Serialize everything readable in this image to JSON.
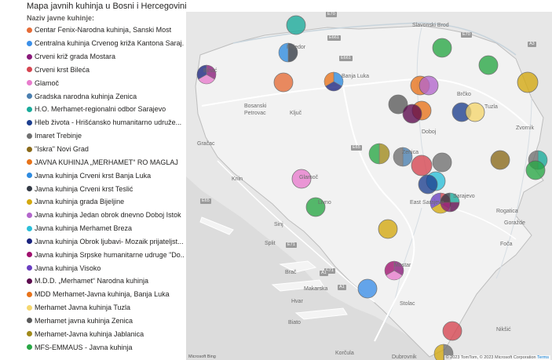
{
  "title": "Mapa javnih kuhinja u Bosni i Hercegovini",
  "legend": {
    "title": "Naziv javne kuhinje:",
    "items": [
      {
        "label": "Centar Fenix-Narodna kuhinja, Sanski Most",
        "color": "#e66c37"
      },
      {
        "label": "Centralna kuhinja Crvenog križa Kantona Saraj...",
        "color": "#3b8fe8"
      },
      {
        "label": "Crveni križ grada Mostara",
        "color": "#8a1a7a"
      },
      {
        "label": "Crveni krst Bileća",
        "color": "#d64550"
      },
      {
        "label": "Glamoč",
        "color": "#e87ccd"
      },
      {
        "label": "Gradska narodna kuhinja Zenica",
        "color": "#4a7fb0"
      },
      {
        "label": "H.O. Merhamet-regionalni odbor Sarajevo",
        "color": "#1aab9b"
      },
      {
        "label": "Hleb života - Hrišćansko humanitarno udruže...",
        "color": "#1d3f8f"
      },
      {
        "label": "Imaret Trebinje",
        "color": "#707070"
      },
      {
        "label": "\"Iskra\" Novi Grad",
        "color": "#8a6a1a"
      },
      {
        "label": "JAVNA KUHINJA „MERHAMET“ RO MAGLAJ",
        "color": "#e8731a"
      },
      {
        "label": "Javna kuhinja Crveni krst Banja Luka",
        "color": "#2e8be0"
      },
      {
        "label": "Javna kuhinja Crveni krst Teslić",
        "color": "#333a45"
      },
      {
        "label": "Javna kuhinja grada Bijeljine",
        "color": "#d4a90f"
      },
      {
        "label": "Javna kuhinja Jedan obrok dnevno Doboj Istok",
        "color": "#b366cc"
      },
      {
        "label": "Javna kuhinja Merhamet Breza",
        "color": "#2bbfd9"
      },
      {
        "label": "Javna kuhinja Obrok ljubavi- Mozaik prijateljst...",
        "color": "#1a237e"
      },
      {
        "label": "Javna kuhinja Srpske humanitarne udruge \"Do...",
        "color": "#a0106e"
      },
      {
        "label": "Javna kuhinja Visoko",
        "color": "#6a3fc1"
      },
      {
        "label": "M.D.D. „Merhamet“ Narodna kuhinja",
        "color": "#5c0a4e"
      },
      {
        "label": "MDD Merhamet-Javna kuhinja, Banja Luka",
        "color": "#e8731a"
      },
      {
        "label": "Merhamet Javna kuhinja Tuzla",
        "color": "#f5d76e"
      },
      {
        "label": "Merhamet javna kuhinja Zenica",
        "color": "#5a5a5a"
      },
      {
        "label": "Merhamet-Javna kuhinja Jablanica",
        "color": "#a08a1a"
      },
      {
        "label": "MFS-EMMAUS - Javna kuhinja",
        "color": "#28a745"
      }
    ]
  },
  "map": {
    "labels": [
      "Slavonski Brod",
      "Banja Luka",
      "Bosanski",
      "Petrovac",
      "Ključ",
      "Gračac",
      "Knin",
      "Sinj",
      "Split",
      "Mostar",
      "Stolac",
      "Brač",
      "Makarska",
      "Hvar",
      "Biato",
      "Korčula",
      "Tuzla",
      "Zvornik",
      "Rogatica",
      "Goražde",
      "Foča",
      "East Sarajevo",
      "Sarajevo",
      "Zenica",
      "Doboj",
      "Brčko",
      "Nikšić",
      "Dubrovnik",
      "Prijedor",
      "Bihać",
      "Glamoč",
      "Livno"
    ],
    "road_shields": [
      "E70",
      "E661",
      "E661",
      "E70",
      "A3",
      "E65",
      "E71",
      "E65",
      "A1",
      "E71",
      "A1"
    ],
    "attribution": "© 2023 TomTom, © 2023 Microsoft Corporation",
    "terms": "Terms",
    "bing": "Microsoft Bing"
  }
}
